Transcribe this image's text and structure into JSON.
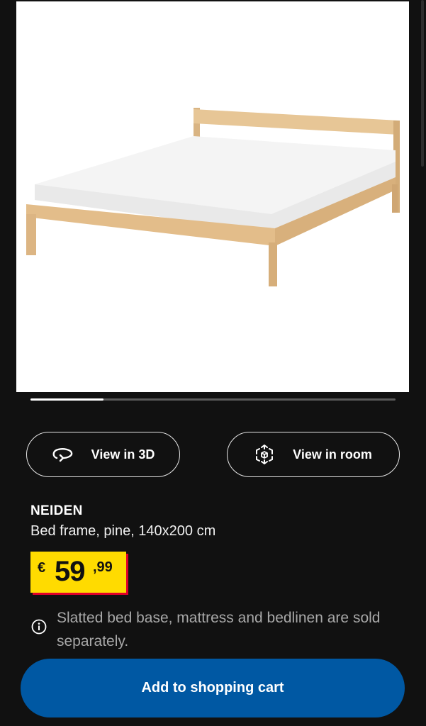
{
  "gallery": {
    "image_alt": "NEIDEN pine bed frame with white mattress",
    "progress_fraction": 0.2
  },
  "actions": {
    "view_3d_label": "View in 3D",
    "view_room_label": "View in room"
  },
  "product": {
    "name": "NEIDEN",
    "description": "Bed frame, pine, 140x200 cm",
    "price": {
      "currency": "€",
      "integer": "59",
      "decimal": ",99"
    },
    "notice": "Slatted bed base, mattress and bedlinen are sold separately."
  },
  "cart": {
    "add_label": "Add to shopping cart"
  },
  "colors": {
    "background": "#111111",
    "price_tag": "#ffdb00",
    "price_shadow": "#e0002a",
    "primary_button": "#0058a3"
  },
  "icons": {
    "view_3d": "rotate-3d-icon",
    "view_room": "ar-cube-icon",
    "notice": "info-icon"
  }
}
